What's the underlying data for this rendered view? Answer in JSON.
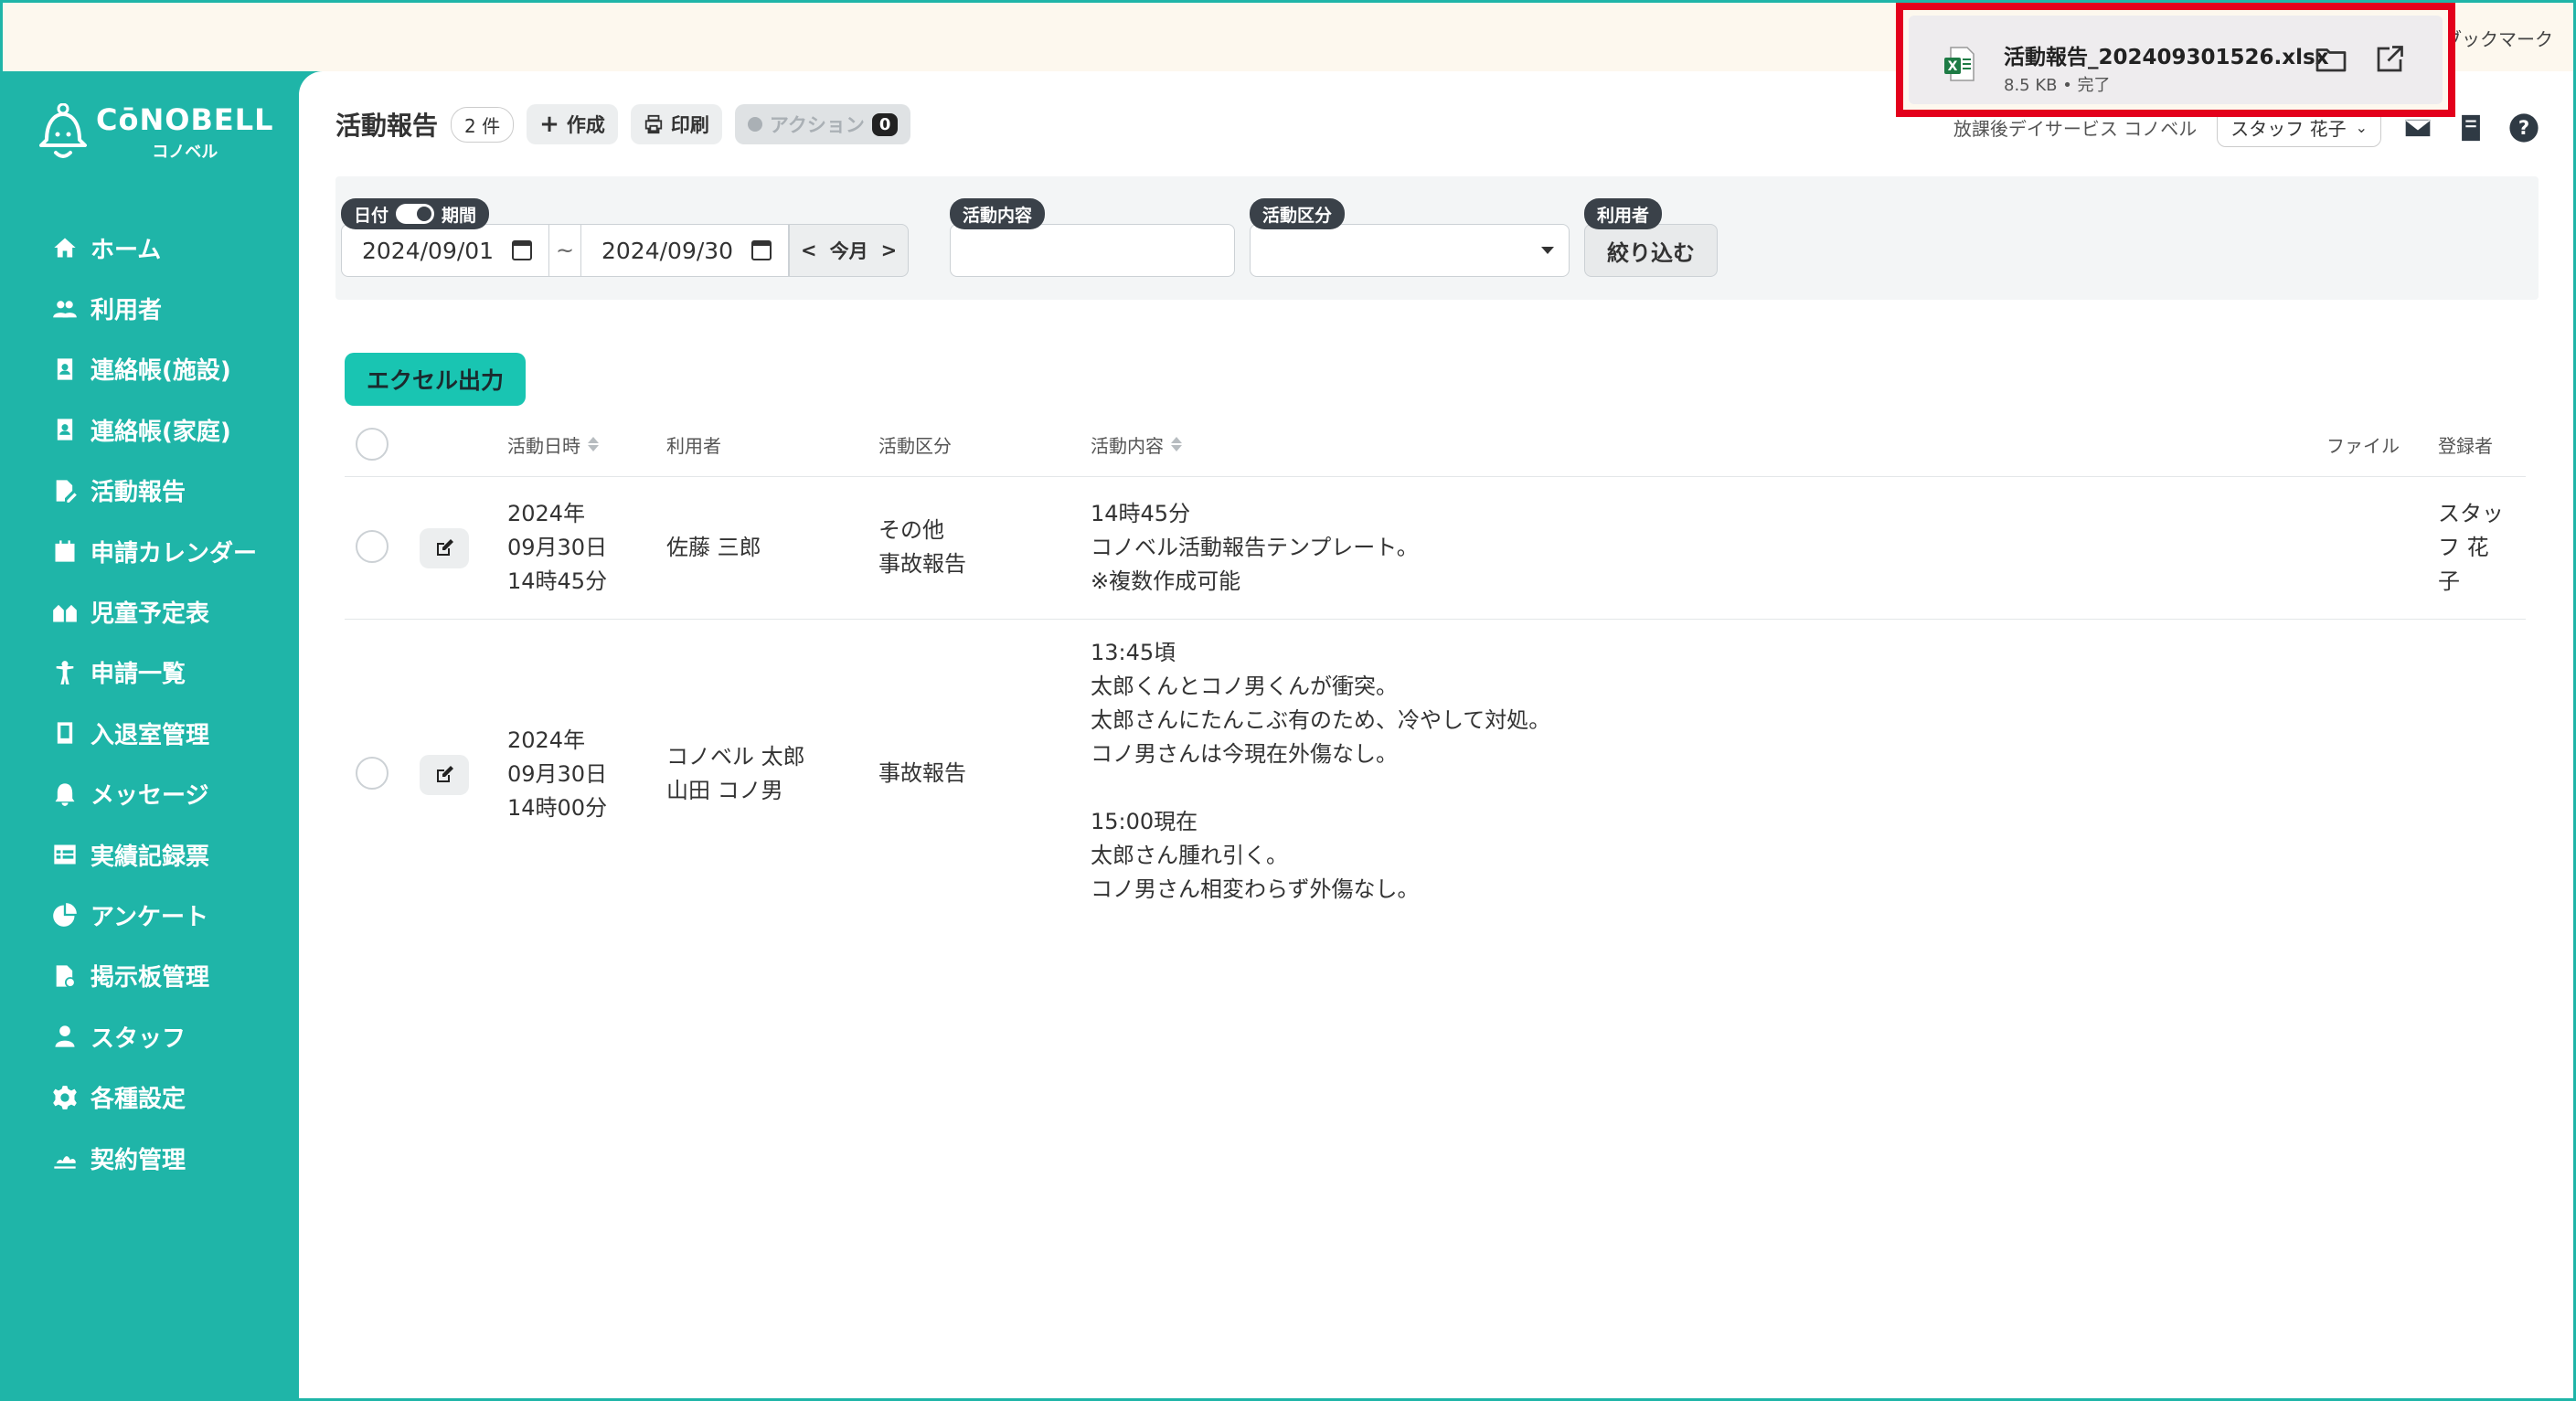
{
  "browser": {
    "bookmark_hint": "のブックマーク"
  },
  "download": {
    "file_name": "活動報告_202409301526.xlsx",
    "meta": "8.5 KB • 完了",
    "icon": "excel-file-icon",
    "highlight_color": "#e3001b"
  },
  "logo": {
    "main": "CōNOBELL",
    "sub": "コノベル"
  },
  "sidebar": {
    "items": [
      {
        "label": "ホーム",
        "icon": "home-icon"
      },
      {
        "label": "利用者",
        "icon": "users-icon"
      },
      {
        "label": "連絡帳(施設)",
        "icon": "contact-book-icon"
      },
      {
        "label": "連絡帳(家庭)",
        "icon": "contact-book-icon"
      },
      {
        "label": "活動報告",
        "icon": "report-edit-icon"
      },
      {
        "label": "申請カレンダー",
        "icon": "calendar-icon"
      },
      {
        "label": "児童予定表",
        "icon": "schedule-icon"
      },
      {
        "label": "申請一覧",
        "icon": "child-icon"
      },
      {
        "label": "入退室管理",
        "icon": "tablet-icon"
      },
      {
        "label": "メッセージ",
        "icon": "bell-icon"
      },
      {
        "label": "実績記録票",
        "icon": "table-icon"
      },
      {
        "label": "アンケート",
        "icon": "pie-chart-icon"
      },
      {
        "label": "掲示板管理",
        "icon": "board-icon"
      },
      {
        "label": "スタッフ",
        "icon": "staff-icon"
      },
      {
        "label": "各種設定",
        "icon": "gear-icon"
      },
      {
        "label": "契約管理",
        "icon": "contract-icon"
      }
    ]
  },
  "header": {
    "title": "活動報告",
    "count": "2 件",
    "create_label": "作成",
    "print_label": "印刷",
    "action_label": "アクション",
    "action_count": "0",
    "facility": "放課後デイサービス コノベル",
    "staff": "スタッフ 花子"
  },
  "filters": {
    "date_label": "日付",
    "period_label": "期間",
    "date_from": "2024/09/01",
    "tilde": "~",
    "date_to": "2024/09/30",
    "this_month": "今月",
    "content_label": "活動内容",
    "content_value": "",
    "category_label": "活動区分",
    "category_value": "",
    "user_label": "利用者",
    "narrow_label": "絞り込む"
  },
  "excel_button": "エクセル出力",
  "table": {
    "columns": {
      "datetime": "活動日時",
      "user": "利用者",
      "category": "活動区分",
      "content": "活動内容",
      "file": "ファイル",
      "registrant": "登録者"
    },
    "rows": [
      {
        "date_lines": [
          "2024年",
          "09月30日",
          "14時45分"
        ],
        "user_lines": [
          "佐藤 三郎"
        ],
        "category_lines": [
          "その他",
          "事故報告"
        ],
        "content_lines": [
          "14時45分",
          "コノベル活動報告テンプレート。",
          "※複数作成可能"
        ],
        "file": "",
        "registrant_lines": [
          "スタッ",
          "フ 花",
          "子"
        ]
      },
      {
        "date_lines": [
          "2024年",
          "09月30日",
          "14時00分"
        ],
        "user_lines": [
          "コノベル 太郎",
          "山田 コノ男"
        ],
        "category_lines": [
          "事故報告"
        ],
        "content_lines": [
          "13:45頃",
          "太郎くんとコノ男くんが衝突。",
          "太郎さんにたんこぶ有のため、冷やして対処。",
          "コノ男さんは今現在外傷なし。",
          "",
          "15:00現在",
          "太郎さん腫れ引く。",
          "コノ男さん相変わらず外傷なし。"
        ],
        "file": "",
        "registrant_lines": []
      }
    ]
  },
  "colors": {
    "brand": "#1fb5a8",
    "excel_button": "#19c5b2",
    "label_dark": "#3a4149"
  }
}
